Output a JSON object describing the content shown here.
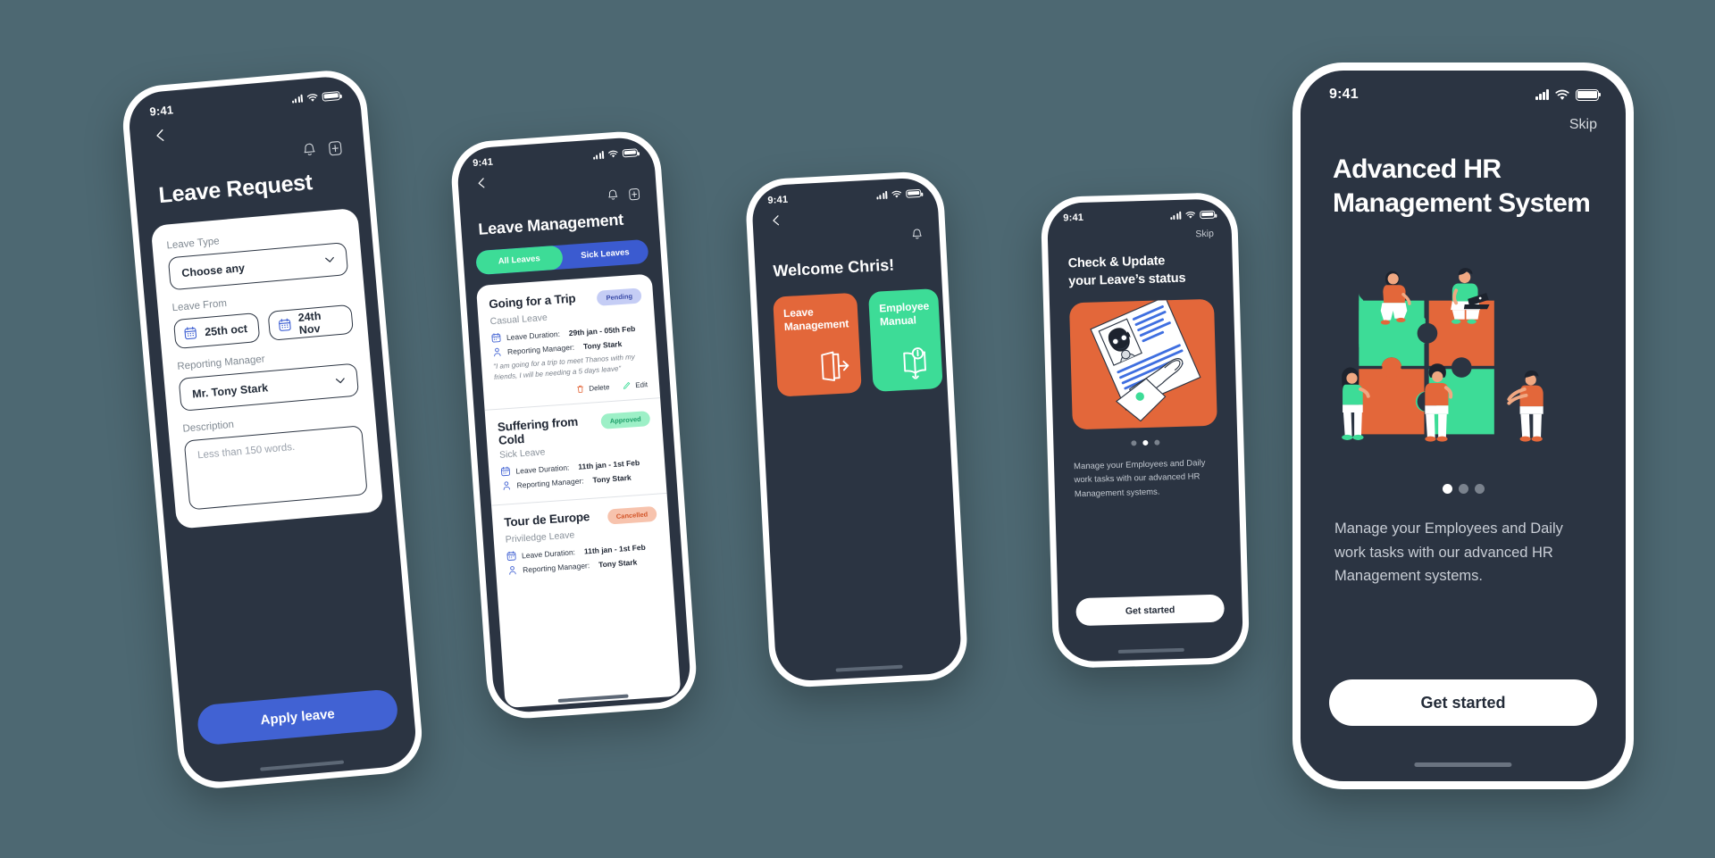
{
  "canvas": {
    "background": "#4d6872"
  },
  "palette": {
    "dark": "#2b3442",
    "blue": "#4162d3",
    "green": "#3ddc97",
    "orange": "#e3673a",
    "white": "#ffffff"
  },
  "phone1": {
    "status": {
      "time": "9:41"
    },
    "icons": {
      "back": "back-arrow-icon",
      "bell": "bell-icon",
      "box": "add-box-icon"
    },
    "title": "Leave Request",
    "form": {
      "leave_type_label": "Leave Type",
      "leave_type_value": "Choose any",
      "leave_from_label": "Leave From",
      "date_start": "25th oct",
      "date_end": "24th Nov",
      "manager_label": "Reporting Manager",
      "manager_value": "Mr. Tony Stark",
      "description_label": "Description",
      "description_placeholder": "Less than 150 words."
    },
    "apply_button": "Apply leave"
  },
  "phone2": {
    "status": {
      "time": "9:41"
    },
    "title": "Leave Management",
    "tabs": [
      {
        "label": "All Leaves",
        "active": true
      },
      {
        "label": "Sick Leaves",
        "active": false
      }
    ],
    "labels": {
      "duration": "Leave Duration:",
      "manager": "Reporting Manager:",
      "delete": "Delete",
      "edit": "Edit"
    },
    "leaves": [
      {
        "title": "Going for a Trip",
        "type": "Casual Leave",
        "status": "Pending",
        "status_class": "pending",
        "duration": "29th jan - 05th Feb",
        "manager": "Tony Stark",
        "note": "\"I am going for a trip to meet Thanos with my friends, I will be needing a 5 days leave\"",
        "has_actions": true
      },
      {
        "title": "Suffering from Cold",
        "type": "Sick Leave",
        "status": "Approved",
        "status_class": "approved",
        "duration": "11th jan - 1st Feb",
        "manager": "Tony Stark",
        "note": "",
        "has_actions": false
      },
      {
        "title": "Tour de Europe",
        "type": "Priviledge Leave",
        "status": "Cancelled",
        "status_class": "cancelled",
        "duration": "11th jan - 1st Feb",
        "manager": "Tony Stark",
        "note": "",
        "has_actions": false
      }
    ]
  },
  "phone3": {
    "status": {
      "time": "9:41"
    },
    "title": "Welcome Chris!",
    "tiles": [
      {
        "label": "Leave Management",
        "color": "#e3673a",
        "icon": "logout-door-icon"
      },
      {
        "label": "Employee Manual",
        "color": "#3ddc97",
        "icon": "open-book-info-icon"
      }
    ]
  },
  "phone4": {
    "status": {
      "time": "9:41"
    },
    "skip": "Skip",
    "title": "Check & Update\nyour Leave’s status",
    "illustration": "hand-holding-resume-illustration",
    "pager": {
      "count": 3,
      "active_index": 1
    },
    "body": "Manage your Employees and Daily work tasks with our advanced HR Management systems.",
    "cta": "Get started"
  },
  "phone5": {
    "status": {
      "time": "9:41"
    },
    "skip": "Skip",
    "title": "Advanced HR Management System",
    "illustration": "team-puzzle-pieces-illustration",
    "pager": {
      "count": 3,
      "active_index": 0
    },
    "body": "Manage your Employees and Daily work tasks with our advanced HR Management systems.",
    "cta": "Get started"
  }
}
